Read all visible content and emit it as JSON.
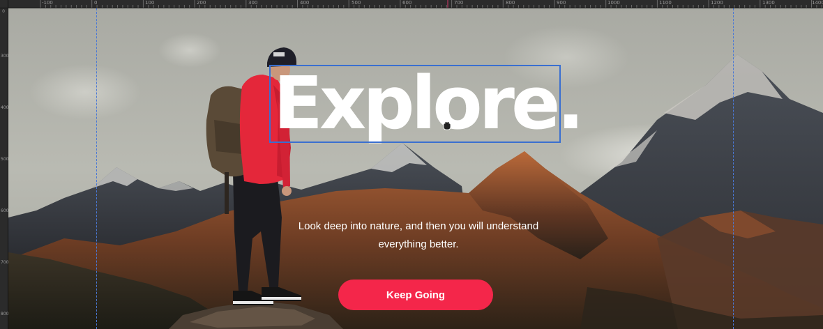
{
  "ruler": {
    "top_labels": [
      "-100",
      "0",
      "100",
      "200",
      "300",
      "400",
      "500",
      "600",
      "700",
      "800",
      "900",
      "1000",
      "1100",
      "1200",
      "1300",
      "1400"
    ],
    "left_labels": [
      "0",
      "300",
      "400",
      "500",
      "600",
      "700",
      "800"
    ]
  },
  "hero": {
    "title": "Explore.",
    "subtitle": "Look deep into nature, and then you will understand everything better.",
    "cta_label": "Keep Going"
  },
  "colors": {
    "cta": "#f4264a",
    "guide": "#4a78d6",
    "selection": "#3a6fd0",
    "sky": "#b7b8b1",
    "jacket": "#e4273a"
  },
  "icons": {
    "cursor": "hand-grab-icon",
    "hiker": "hiker-image",
    "mountains": "mountain-landscape-image"
  }
}
